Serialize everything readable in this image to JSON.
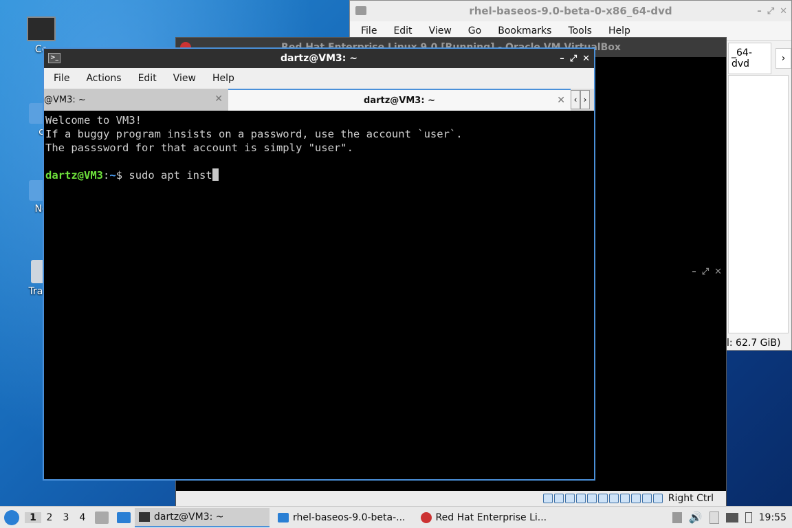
{
  "desktop": {
    "icons": [
      {
        "label": "Co"
      },
      {
        "label": "c"
      },
      {
        "label": "Ne"
      },
      {
        "label": "Trash"
      }
    ]
  },
  "file_manager": {
    "title": "rhel-baseos-9.0-beta-0-x86_64-dvd",
    "menu": [
      "File",
      "Edit",
      "View",
      "Go",
      "Bookmarks",
      "Tools",
      "Help"
    ],
    "path_tab": "_64-dvd",
    "free_space": "l: 62.7 GiB)"
  },
  "virtualbox": {
    "title": "Red Hat Enterprise Linux 9.0 [Running] - Oracle VM VirtualBox",
    "host_key": "Right Ctrl"
  },
  "terminal": {
    "title": "dartz@VM3: ~",
    "menu": [
      "File",
      "Actions",
      "Edit",
      "View",
      "Help"
    ],
    "tabs": [
      {
        "label": "@VM3: ~"
      },
      {
        "label": "dartz@VM3: ~"
      }
    ],
    "lines": [
      "Welcome to VM3!",
      "If a buggy program insists on a password, use the account `user`.",
      "The passsword for that account is simply \"user\"."
    ],
    "prompt_user": "dartz@VM3",
    "prompt_sep": ":",
    "prompt_path": "~",
    "prompt_dollar": "$ ",
    "command": "sudo apt inst"
  },
  "taskbar": {
    "workspaces": [
      "1",
      "2",
      "3",
      "4"
    ],
    "tasks": [
      {
        "label": "dartz@VM3: ~"
      },
      {
        "label": "rhel-baseos-9.0-beta-..."
      },
      {
        "label": "Red Hat Enterprise Li..."
      }
    ],
    "clock": "19:55"
  },
  "colors": {
    "accent": "#4a90d9",
    "prompt_user": "#6ee13b",
    "prompt_path": "#4fa6ff"
  }
}
